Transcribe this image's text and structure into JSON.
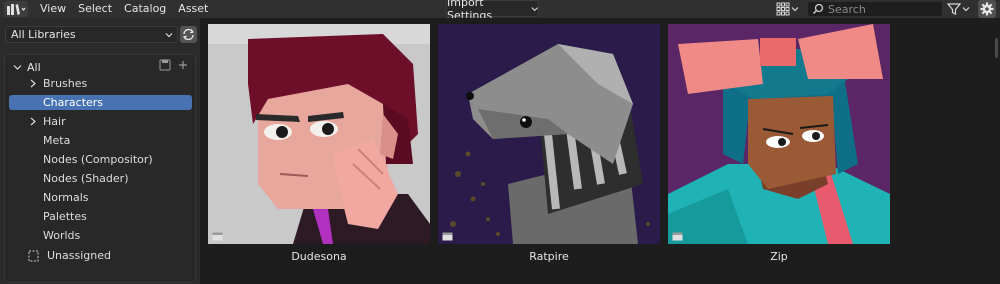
{
  "header": {
    "menu": [
      "View",
      "Select",
      "Catalog",
      "Asset"
    ],
    "import_settings": "Import Settings",
    "search_placeholder": "Search"
  },
  "sidebar": {
    "library_select": "All Libraries",
    "tree_root": "All",
    "items": [
      {
        "label": "Brushes",
        "expandable": true
      },
      {
        "label": "Characters",
        "expandable": false,
        "active": true
      },
      {
        "label": "Hair",
        "expandable": true
      },
      {
        "label": "Meta",
        "expandable": false
      },
      {
        "label": "Nodes (Compositor)",
        "expandable": false
      },
      {
        "label": "Nodes (Shader)",
        "expandable": false
      },
      {
        "label": "Normals",
        "expandable": false
      },
      {
        "label": "Palettes",
        "expandable": false
      },
      {
        "label": "Worlds",
        "expandable": false
      }
    ],
    "unassigned": "Unassigned"
  },
  "assets": [
    {
      "name": "Dudesona"
    },
    {
      "name": "Ratpire"
    },
    {
      "name": "Zip"
    }
  ],
  "colors": {
    "accent": "#4772b3",
    "header_bg": "#303030",
    "sidebar_bg": "#2b2b2b",
    "main_bg": "#1d1d1d"
  }
}
